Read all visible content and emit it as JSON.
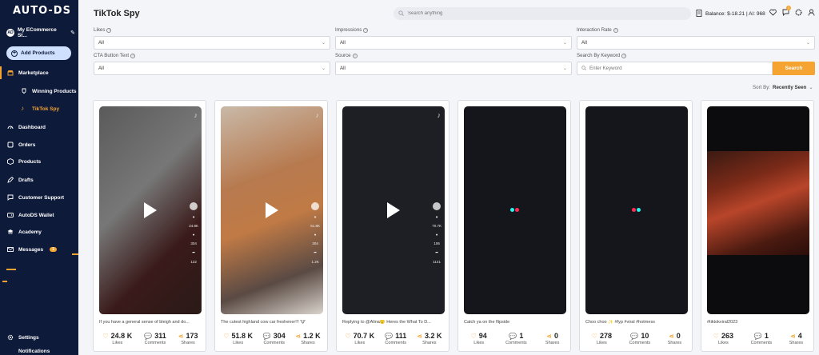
{
  "sidebar": {
    "logo": "AUTO-DS",
    "store_name": "My ECommerce St...",
    "store_avatar": "AD",
    "add_products": "Add Products",
    "items": [
      {
        "label": "Marketplace"
      },
      {
        "label": "Winning Products"
      },
      {
        "label": "TikTok Spy"
      },
      {
        "label": "Dashboard"
      },
      {
        "label": "Orders"
      },
      {
        "label": "Products"
      },
      {
        "label": "Drafts"
      },
      {
        "label": "Customer Support"
      },
      {
        "label": "AutoDS Wallet"
      },
      {
        "label": "Academy"
      },
      {
        "label": "Messages",
        "badge": "1"
      },
      {
        "label": "Settings"
      },
      {
        "label": "Notifications"
      }
    ]
  },
  "header": {
    "title": "TikTok Spy",
    "search_placeholder": "Search anything",
    "balance": "Balance: $-18.21 | AI: 968",
    "notif_count": "1"
  },
  "filters": {
    "likes": {
      "label": "Likes",
      "value": "All"
    },
    "impressions": {
      "label": "Impressions",
      "value": "All"
    },
    "interaction_rate": {
      "label": "Interaction Rate",
      "value": "All"
    },
    "cta": {
      "label": "CTA Button Text",
      "value": "All"
    },
    "source": {
      "label": "Source",
      "value": "All"
    },
    "keyword": {
      "label": "Search By Keyword",
      "placeholder": "Enter Keyword"
    },
    "search_button": "Search"
  },
  "sort": {
    "label": "Sort By:",
    "value": "Recently Seen"
  },
  "stat_labels": {
    "likes": "Likes",
    "comments": "Comments",
    "shares": "Shares"
  },
  "cards": [
    {
      "caption": "If you have a general sense of bleigh and do...",
      "likes": "24.8 K",
      "comments": "311",
      "shares": "173",
      "side": [
        "24.8K",
        "304",
        "122"
      ]
    },
    {
      "caption": "The cutest highland cow car freshener!!! 🐮",
      "likes": "51.8 K",
      "comments": "304",
      "shares": "1.2 K",
      "side": [
        "51.8K",
        "304",
        "1.2K"
      ]
    },
    {
      "caption": "Replying to @Alina🙂 Heres the What To D...",
      "likes": "70.7 K",
      "comments": "111",
      "shares": "3.2 K",
      "side": [
        "70.7K",
        "106",
        "1141"
      ]
    },
    {
      "caption": "Catch ya on the flipside",
      "likes": "94",
      "comments": "1",
      "shares": "0"
    },
    {
      "caption": "Choo choo ✨ #fyp #viral #hotmess",
      "likes": "278",
      "comments": "10",
      "shares": "0"
    },
    {
      "caption": "#tiktokviral2023",
      "likes": "263",
      "comments": "1",
      "shares": "4"
    }
  ],
  "colors": {
    "accent": "#f5a431",
    "sidebar": "#0e1a3a"
  }
}
